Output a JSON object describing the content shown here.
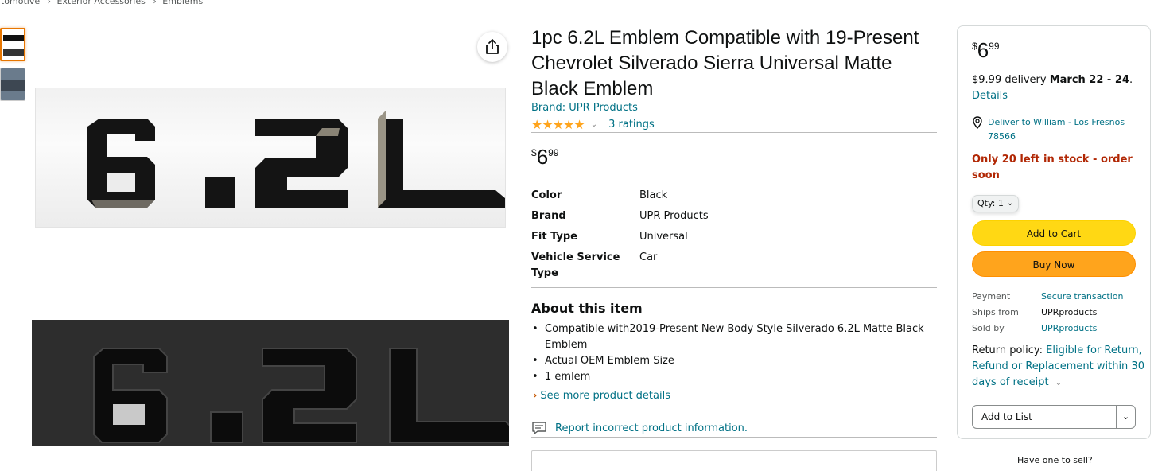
{
  "breadcrumb": {
    "items": [
      "utomotive",
      "Exterior Accessories",
      "Emblems"
    ],
    "separator": "›"
  },
  "gallery": {
    "thumb_count": 2,
    "emblem_text": "6.2L",
    "share_icon": "share-icon"
  },
  "product": {
    "title": "1pc 6.2L Emblem Compatible with 19-Present Chevrolet Silverado Sierra Universal Matte Black Emblem",
    "brand_link": "Brand: UPR Products",
    "rating_stars": "★★★★★",
    "rating_value": 5,
    "ratings_count": "3 ratings",
    "price": {
      "symbol": "$",
      "whole": "6",
      "fraction": "99"
    }
  },
  "specs": [
    {
      "key": "Color",
      "value": "Black"
    },
    {
      "key": "Brand",
      "value": "UPR Products"
    },
    {
      "key": "Fit Type",
      "value": "Universal"
    },
    {
      "key": "Vehicle Service Type",
      "value": "Car"
    }
  ],
  "about": {
    "title": "About this item",
    "bullets": [
      "Compatible with2019-Present New Body Style Silverado 6.2L Matte Black Emblem",
      "Actual OEM Emblem Size",
      "1 emlem"
    ],
    "see_more": "See more product details",
    "report": "Report incorrect product information."
  },
  "buybox": {
    "price": {
      "symbol": "$",
      "whole": "6",
      "fraction": "99"
    },
    "delivery_prefix": "$9.99 delivery",
    "delivery_date": "March 22 - 24",
    "delivery_suffix": ".",
    "details_link": "Details",
    "deliver_to": "Deliver to William - Los Fresnos 78566",
    "stock": "Only 20 left in stock - order soon",
    "qty_label": "Qty:",
    "qty_value": "1",
    "add_to_cart": "Add to Cart",
    "buy_now": "Buy Now",
    "payment_label": "Payment",
    "payment_value": "Secure transaction",
    "ships_from_label": "Ships from",
    "ships_from_value": "UPRproducts",
    "sold_by_label": "Sold by",
    "sold_by_value": "UPRproducts",
    "return_label": "Return policy:",
    "return_link": "Eligible for Return, Refund or Replacement within 30 days of receipt",
    "add_to_list": "Add to List",
    "have_one": "Have one to sell?"
  },
  "colors": {
    "link": "#007185",
    "stock_red": "#b12704",
    "cart_yellow": "#ffd814",
    "buy_orange": "#ffa41c",
    "star": "#ffa41c"
  }
}
